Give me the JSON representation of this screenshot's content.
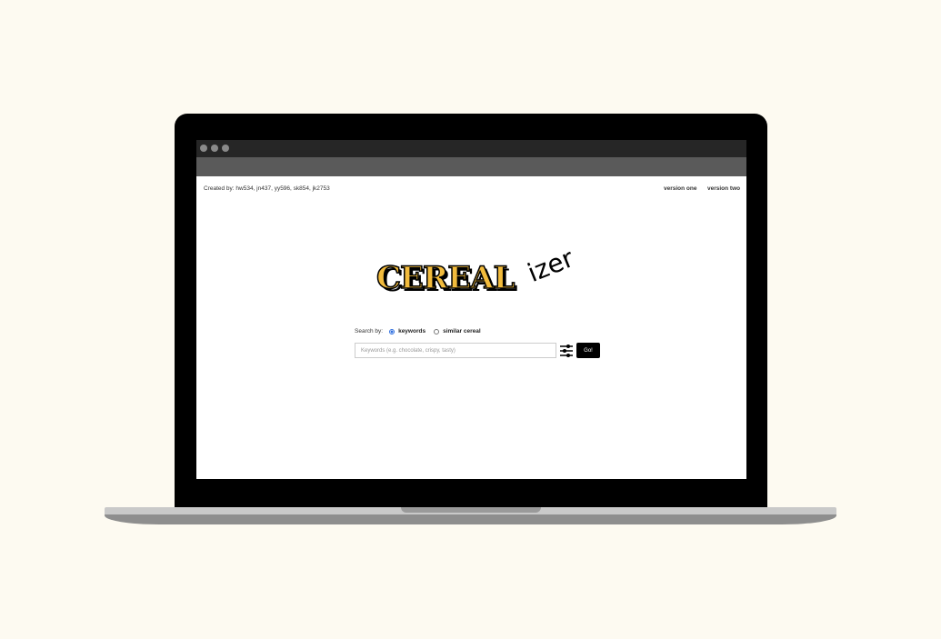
{
  "header": {
    "credits": "Created by: hw534, jn437, yy596, sk854, jk2753",
    "nav": [
      "version one",
      "version two"
    ]
  },
  "logo": {
    "main": "CEREAL",
    "suffix": "izer"
  },
  "search": {
    "label": "Search by:",
    "options": [
      {
        "label": "keywords",
        "selected": true
      },
      {
        "label": "similar cereal",
        "selected": false
      }
    ],
    "placeholder": "Keywords (e.g. chocolate, crispy, tasty)",
    "button": "Go!"
  },
  "colors": {
    "background": "#fdfaf1",
    "logo": "#f2bb3c",
    "radio": "#2f6fe0"
  }
}
